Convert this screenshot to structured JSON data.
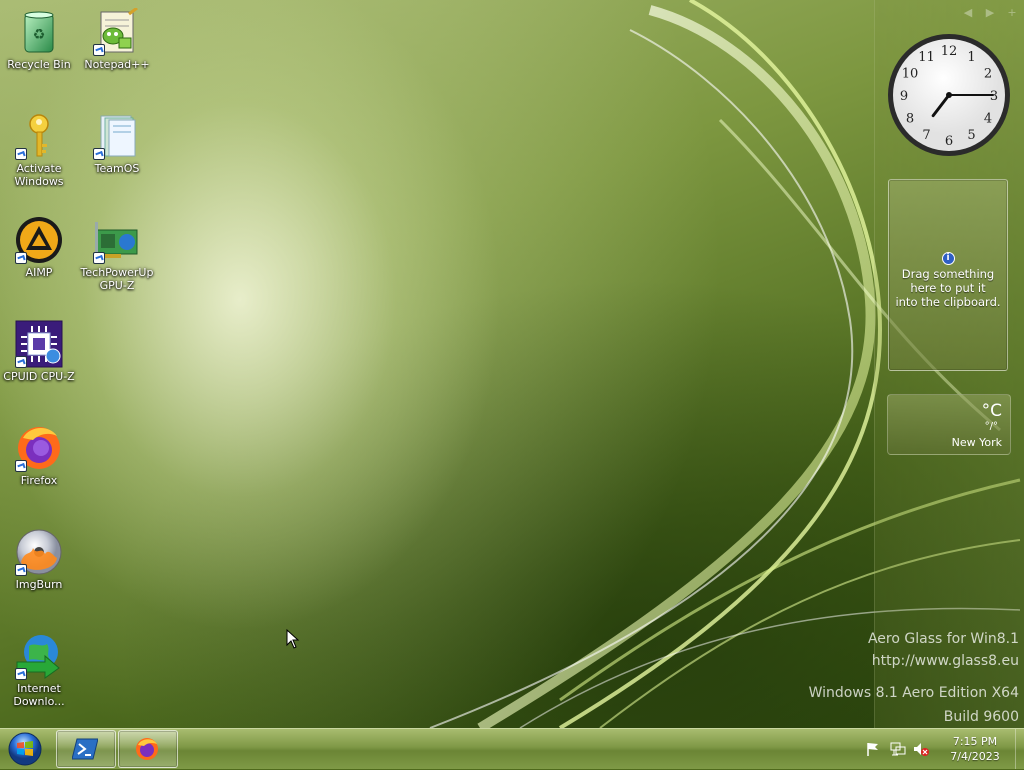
{
  "desktop": {
    "icons": [
      {
        "label": "Recycle Bin",
        "icon": "recycle-bin-icon"
      },
      {
        "label": "Notepad++",
        "icon": "notepad-plus-plus-icon"
      },
      {
        "label": "Activate\nWindows",
        "icon": "key-icon"
      },
      {
        "label": "TeamOS",
        "icon": "folder-icon"
      },
      {
        "label": "AIMP",
        "icon": "aimp-icon"
      },
      {
        "label": "TechPowerUp\nGPU-Z",
        "icon": "gpu-z-icon"
      },
      {
        "label": "CPUID CPU-Z",
        "icon": "cpu-z-icon"
      },
      {
        "label": "Firefox",
        "icon": "firefox-icon"
      },
      {
        "label": "ImgBurn",
        "icon": "imgburn-icon"
      },
      {
        "label": "Internet\nDownlo...",
        "icon": "internet-download-manager-icon"
      }
    ]
  },
  "sidebar": {
    "nav": [
      "◀",
      "▶",
      "+"
    ],
    "clock": {
      "hour": 7,
      "minute": 15
    },
    "clipboard": {
      "text": "Drag something\nhere to put it\ninto the clipboard."
    },
    "weather": {
      "temp": "°C",
      "range": "°/°",
      "city": "New York"
    }
  },
  "watermark": {
    "line1": "Aero Glass for Win8.1",
    "line2": "http://www.glass8.eu",
    "line3": "Windows 8.1 Aero Edition X64",
    "line4": "Build 9600"
  },
  "taskbar": {
    "start_icon": "windows-orb-icon",
    "buttons": [
      {
        "icon": "powershell-icon"
      },
      {
        "icon": "firefox-icon"
      }
    ],
    "tray": {
      "icons": [
        "flag-icon",
        "network-icon",
        "volume-muted-icon"
      ],
      "time": "7:15 PM",
      "date": "7/4/2023"
    }
  },
  "colors": {
    "accent": "#7f9846",
    "orb": "#2a6fd8"
  }
}
